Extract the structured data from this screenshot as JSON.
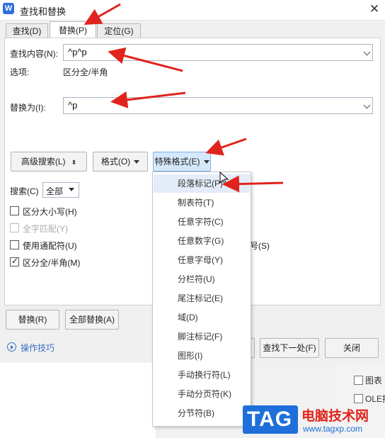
{
  "window": {
    "title": "查找和替换",
    "app_icon_letter": "W",
    "close_glyph": "✕"
  },
  "tabs": [
    {
      "label": "查找(D)",
      "active": false
    },
    {
      "label": "替换(P)",
      "active": true
    },
    {
      "label": "定位(G)",
      "active": false
    }
  ],
  "find": {
    "label": "查找内容(N):",
    "value": "^p^p"
  },
  "options": {
    "label": "选项:",
    "value": "区分全/半角"
  },
  "replace": {
    "label": "替换为(I):",
    "value": "^p"
  },
  "buttons": {
    "advanced": "高级搜索(L)",
    "format": "格式(O)",
    "special": "特殊格式(E)",
    "replace": "替换(R)",
    "replace_all": "全部替换(A)",
    "find_next": "查找下一处(F)",
    "close": "关闭"
  },
  "search": {
    "label": "搜索(C)",
    "value": "全部"
  },
  "checkboxes": [
    {
      "label": "区分大小写(H)",
      "checked": false,
      "disabled": false
    },
    {
      "label": "全字匹配(Y)",
      "checked": false,
      "disabled": true
    },
    {
      "label": "使用通配符(U)",
      "checked": false,
      "disabled": false
    },
    {
      "label": "区分全/半角(M)",
      "checked": true,
      "disabled": false
    }
  ],
  "right_partial": {
    "row3_suffix": "号(S)"
  },
  "tips_link": "操作技巧",
  "special_menu": {
    "items": [
      "段落标记(P)",
      "制表符(T)",
      "任意字符(C)",
      "任意数字(G)",
      "任意字母(Y)",
      "分栏符(U)",
      "尾注标记(E)",
      "域(D)",
      "脚注标记(F)",
      "图形(I)",
      "手动换行符(L)",
      "手动分页符(K)",
      "分节符(B)"
    ],
    "highlighted_index": 0
  },
  "background_doc": {
    "items": [
      "图表",
      "OLE控"
    ]
  },
  "watermark": {
    "logo": "TAG",
    "site_name": "电脑技术网",
    "url": "www.tagxp.com"
  },
  "colors": {
    "accent": "#2f6fdc",
    "arrow": "#e0231c",
    "special_btn": "#d6e8fb",
    "watermark_blue": "#1e6fd9"
  }
}
